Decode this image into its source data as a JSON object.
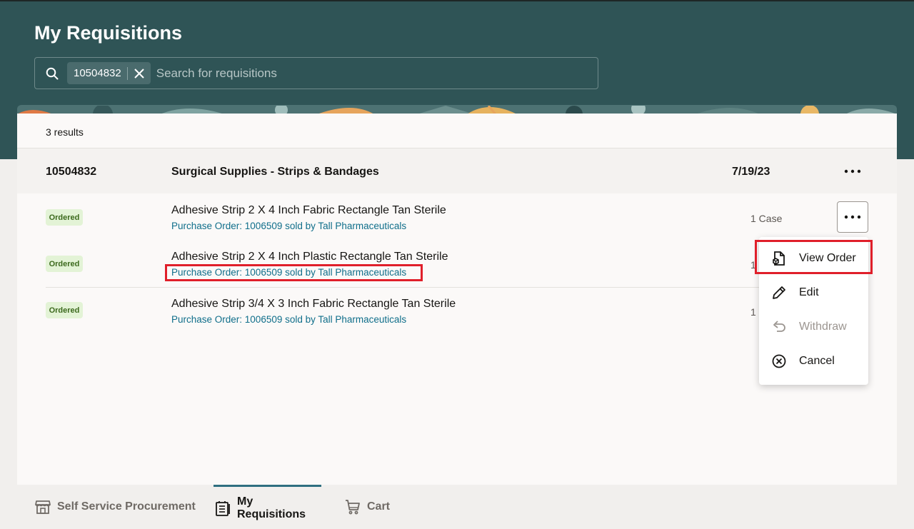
{
  "header": {
    "title": "My Requisitions",
    "search": {
      "chip_value": "10504832",
      "placeholder": "Search for requisitions"
    }
  },
  "results": {
    "count_label": "3 results"
  },
  "requisition": {
    "id": "10504832",
    "title": "Surgical Supplies - Strips & Bandages",
    "date": "7/19/23",
    "lines": [
      {
        "status": "Ordered",
        "title": "Adhesive Strip 2 X 4 Inch Fabric Rectangle Tan Sterile",
        "po": "Purchase Order: 1006509 sold by Tall Pharmaceuticals",
        "qty": "1 Case"
      },
      {
        "status": "Ordered",
        "title": "Adhesive Strip 2 X 4 Inch Plastic Rectangle Tan Sterile",
        "po": "Purchase Order: 1006509 sold by Tall Pharmaceuticals",
        "qty": "1"
      },
      {
        "status": "Ordered",
        "title": "Adhesive Strip 3/4 X 3 Inch Fabric Rectangle Tan Sterile",
        "po": "Purchase Order: 1006509 sold by Tall Pharmaceuticals",
        "qty": "1"
      }
    ]
  },
  "menu": {
    "items": [
      {
        "label": "View Order",
        "icon": "view-order-icon",
        "enabled": true
      },
      {
        "label": "Edit",
        "icon": "pencil-icon",
        "enabled": true
      },
      {
        "label": "Withdraw",
        "icon": "undo-icon",
        "enabled": false
      },
      {
        "label": "Cancel",
        "icon": "cancel-icon",
        "enabled": true
      }
    ]
  },
  "tabs": [
    {
      "label": "Self Service Procurement",
      "icon": "store-icon",
      "active": false
    },
    {
      "label": "My Requisitions",
      "icon": "requisitions-icon",
      "active": true
    },
    {
      "label": "Cart",
      "icon": "cart-icon",
      "active": false
    }
  ],
  "colors": {
    "header_bg": "#2f5456",
    "link": "#0f6e8a",
    "status_bg": "#e3f3d6",
    "status_text": "#3d6a1e",
    "highlight": "#e01f2a",
    "active_tab": "#2f6f80"
  }
}
